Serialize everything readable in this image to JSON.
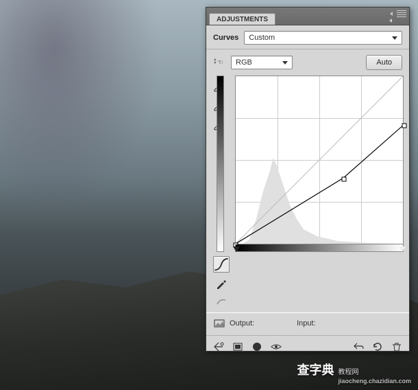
{
  "panel": {
    "tab_label": "ADJUSTMENTS",
    "adjustment_type": "Curves",
    "preset": "Custom",
    "channel": "RGB",
    "auto_label": "Auto",
    "output_label": "Output:",
    "input_label": "Input:"
  },
  "icons": {
    "scrubby": "scrubby-slider",
    "eyedropper_black": "black-point-eyedropper",
    "eyedropper_gray": "gray-point-eyedropper",
    "eyedropper_white": "white-point-eyedropper",
    "curve_tool": "curve-point-tool",
    "pencil_tool": "pencil-tool",
    "smooth_tool": "smooth-tool",
    "clip_preview": "clip-preview",
    "layer_below": "clip-to-layer",
    "view_previous": "view-previous-state",
    "reset": "reset",
    "visibility": "toggle-visibility",
    "delete": "delete-adjustment",
    "collapse": "collapse-panel",
    "menu": "panel-menu",
    "adjustment_icon": "adjustment-icon"
  },
  "chart_data": {
    "type": "line",
    "title": "Curves",
    "xlabel": "Input",
    "ylabel": "Output",
    "xlim": [
      0,
      255
    ],
    "ylim": [
      0,
      255
    ],
    "grid": true,
    "series": [
      {
        "name": "baseline",
        "x": [
          0,
          255
        ],
        "y": [
          0,
          255
        ]
      },
      {
        "name": "RGB",
        "x": [
          0,
          164,
          255
        ],
        "y": [
          0,
          100,
          180
        ]
      }
    ],
    "histogram_peak_x": 55,
    "black_slider": 0,
    "white_slider": 255
  },
  "watermark": {
    "brand": "查字典",
    "tag": "教程网",
    "url": "jiaocheng.chazidian.com"
  }
}
